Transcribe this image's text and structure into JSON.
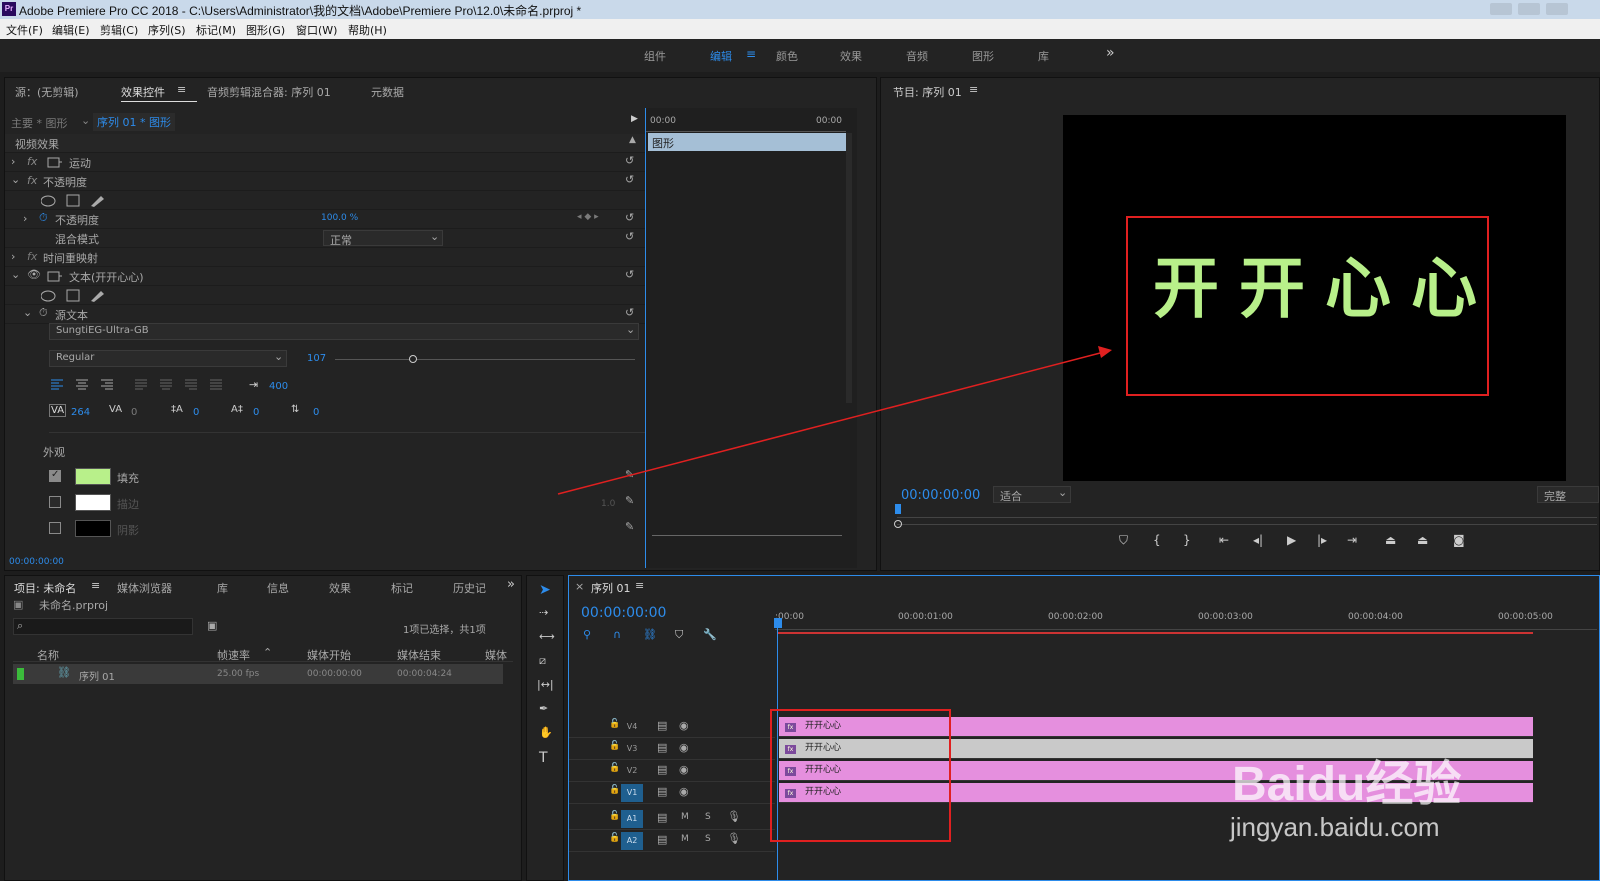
{
  "window": {
    "title": "Adobe Premiere Pro CC 2018 - C:\\Users\\Administrator\\我的文档\\Adobe\\Premiere Pro\\12.0\\未命名.prproj *",
    "app_icon": "Pr"
  },
  "menu": [
    "文件(F)",
    "编辑(E)",
    "剪辑(C)",
    "序列(S)",
    "标记(M)",
    "图形(G)",
    "窗口(W)",
    "帮助(H)"
  ],
  "workspaces": {
    "items": [
      "组件",
      "编辑",
      "颜色",
      "效果",
      "音频",
      "图形",
      "库"
    ],
    "active": "编辑",
    "more": "»"
  },
  "source_panel": {
    "tabs": [
      "源：(无剪辑)",
      "效果控件",
      "音频剪辑混合器: 序列 01",
      "元数据"
    ],
    "active_tab": "效果控件",
    "header": {
      "master": "主要 * 图形",
      "sequence": "序列 01 * 图形"
    },
    "section": "视频效果",
    "motion": "运动",
    "opacity": "不透明度",
    "opacity_prop": "不透明度",
    "opacity_value": "100.0 %",
    "blend_label": "混合模式",
    "blend_value": "正常",
    "time_remap": "时间重映射",
    "text_layer": "文本(开开心心)",
    "source_text": "源文本",
    "font": "SungtiEG-Ultra-GB",
    "style": "Regular",
    "size": "107",
    "tracking_val": "400",
    "kerning": "264",
    "va": "0",
    "leading": "0",
    "baseline": "0",
    "tsume": "0",
    "appearance": "外观",
    "fill_label": "填充",
    "stroke_label": "描边",
    "stroke_width": "1.0",
    "shadow_label": "阴影",
    "fill_color": "#b8f08a",
    "timecode": "00:00:00:00",
    "mini_tl": {
      "start": "00:00",
      "end": "00:00",
      "clip": "图形"
    }
  },
  "program": {
    "title": "节目: 序列 01",
    "timecode": "00:00:00:00",
    "fit": "适合",
    "quality": "完整",
    "text": "开开心心",
    "text_color": "#b8f08a"
  },
  "project": {
    "tabs": [
      "项目: 未命名",
      "媒体浏览器",
      "库",
      "信息",
      "效果",
      "标记",
      "历史记"
    ],
    "file": "未命名.prproj",
    "selected": "1项已选择，共1项",
    "columns": [
      "名称",
      "帧速率",
      "媒体开始",
      "媒体结束",
      "媒体"
    ],
    "rows": [
      {
        "name": "序列 01",
        "fps": "25.00 fps",
        "start": "00:00:00:00",
        "end": "00:00:04:24"
      }
    ]
  },
  "timeline": {
    "title": "序列 01",
    "timecode": "00:00:00:00",
    "ticks": [
      ":00:00",
      "00:00:01:00",
      "00:00:02:00",
      "00:00:03:00",
      "00:00:04:00",
      "00:00:05:00"
    ],
    "video_tracks": [
      "V4",
      "V3",
      "V2",
      "V1"
    ],
    "audio_tracks": [
      "A1",
      "A2"
    ],
    "clip_label": "开开心心",
    "mute": "M",
    "solo": "S"
  },
  "watermark": {
    "brand": "Baidu经验",
    "url": "jingyan.baidu.com"
  },
  "colors": {
    "accent": "#2d8ceb",
    "clip": "#e58fde",
    "clip_selected": "#c9c9c9",
    "annotation": "#e02020"
  }
}
